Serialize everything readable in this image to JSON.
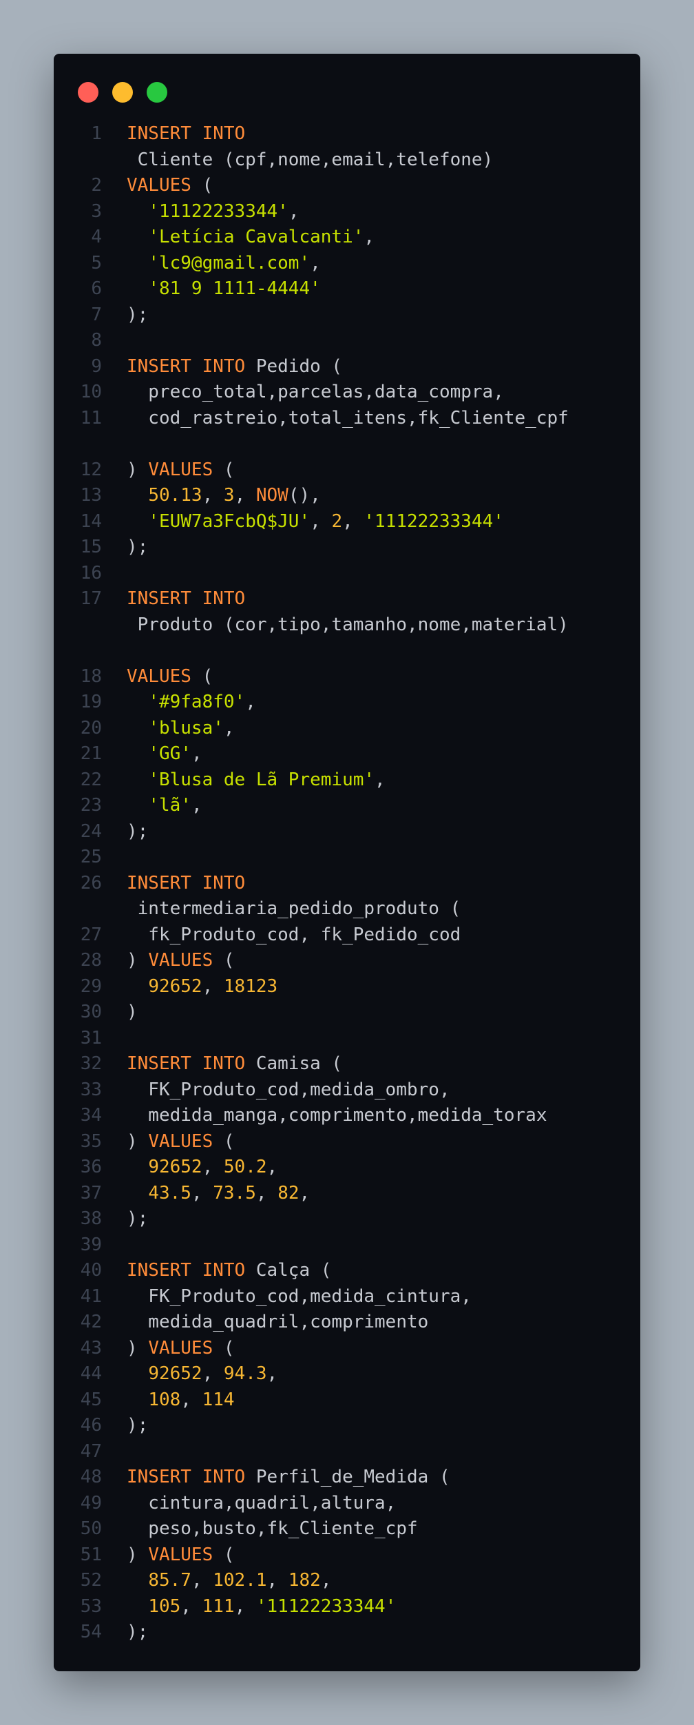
{
  "window": {
    "controls": [
      "close",
      "minimize",
      "maximize"
    ],
    "colors": {
      "close": "#ff5f57",
      "minimize": "#febc2e",
      "maximize": "#28c840",
      "keyword": "#ff8c3a",
      "string": "#c7e000",
      "number": "#f7b733",
      "text": "#c7cad1",
      "line_number": "#3d4452",
      "background": "#0b0d13"
    }
  },
  "code": {
    "lines": [
      {
        "n": "1",
        "tokens": [
          {
            "t": "INSERT INTO",
            "c": "kw"
          }
        ]
      },
      {
        "n": "",
        "tokens": [
          {
            "t": " Cliente (cpf,nome,email,telefone)",
            "c": "pn"
          }
        ]
      },
      {
        "n": "2",
        "tokens": [
          {
            "t": "VALUES",
            "c": "kw"
          },
          {
            "t": " (",
            "c": "pn"
          }
        ]
      },
      {
        "n": "3",
        "tokens": [
          {
            "t": "  ",
            "c": "pn"
          },
          {
            "t": "'11122233344'",
            "c": "str"
          },
          {
            "t": ",",
            "c": "pn"
          }
        ]
      },
      {
        "n": "4",
        "tokens": [
          {
            "t": "  ",
            "c": "pn"
          },
          {
            "t": "'Letícia Cavalcanti'",
            "c": "str"
          },
          {
            "t": ",",
            "c": "pn"
          }
        ]
      },
      {
        "n": "5",
        "tokens": [
          {
            "t": "  ",
            "c": "pn"
          },
          {
            "t": "'lc9@gmail.com'",
            "c": "str"
          },
          {
            "t": ",",
            "c": "pn"
          }
        ]
      },
      {
        "n": "6",
        "tokens": [
          {
            "t": "  ",
            "c": "pn"
          },
          {
            "t": "'81 9 1111-4444'",
            "c": "str"
          }
        ]
      },
      {
        "n": "7",
        "tokens": [
          {
            "t": ");",
            "c": "pn"
          }
        ]
      },
      {
        "n": "8",
        "tokens": []
      },
      {
        "n": "9",
        "tokens": [
          {
            "t": "INSERT INTO",
            "c": "kw"
          },
          {
            "t": " Pedido (",
            "c": "pn"
          }
        ]
      },
      {
        "n": "10",
        "tokens": [
          {
            "t": "  preco_total,parcelas,data_compra,",
            "c": "pn"
          }
        ]
      },
      {
        "n": "11",
        "tokens": [
          {
            "t": "  cod_rastreio,total_itens,fk_Cliente_cpf",
            "c": "pn"
          }
        ]
      },
      {
        "n": "",
        "tokens": []
      },
      {
        "n": "12",
        "tokens": [
          {
            "t": ") ",
            "c": "pn"
          },
          {
            "t": "VALUES",
            "c": "kw"
          },
          {
            "t": " (",
            "c": "pn"
          }
        ]
      },
      {
        "n": "13",
        "tokens": [
          {
            "t": "  ",
            "c": "pn"
          },
          {
            "t": "50.13",
            "c": "num"
          },
          {
            "t": ", ",
            "c": "pn"
          },
          {
            "t": "3",
            "c": "num"
          },
          {
            "t": ", ",
            "c": "pn"
          },
          {
            "t": "NOW",
            "c": "kw"
          },
          {
            "t": "(),",
            "c": "pn"
          }
        ]
      },
      {
        "n": "14",
        "tokens": [
          {
            "t": "  ",
            "c": "pn"
          },
          {
            "t": "'EUW7a3FcbQ$JU'",
            "c": "str"
          },
          {
            "t": ", ",
            "c": "pn"
          },
          {
            "t": "2",
            "c": "num"
          },
          {
            "t": ", ",
            "c": "pn"
          },
          {
            "t": "'11122233344'",
            "c": "str"
          }
        ]
      },
      {
        "n": "15",
        "tokens": [
          {
            "t": ");",
            "c": "pn"
          }
        ]
      },
      {
        "n": "16",
        "tokens": []
      },
      {
        "n": "17",
        "tokens": [
          {
            "t": "INSERT INTO",
            "c": "kw"
          }
        ]
      },
      {
        "n": "",
        "tokens": [
          {
            "t": " Produto (cor,tipo,tamanho,nome,material)",
            "c": "pn"
          }
        ]
      },
      {
        "n": "",
        "tokens": []
      },
      {
        "n": "18",
        "tokens": [
          {
            "t": "VALUES",
            "c": "kw"
          },
          {
            "t": " (",
            "c": "pn"
          }
        ]
      },
      {
        "n": "19",
        "tokens": [
          {
            "t": "  ",
            "c": "pn"
          },
          {
            "t": "'#9fa8f0'",
            "c": "str"
          },
          {
            "t": ",",
            "c": "pn"
          }
        ]
      },
      {
        "n": "20",
        "tokens": [
          {
            "t": "  ",
            "c": "pn"
          },
          {
            "t": "'blusa'",
            "c": "str"
          },
          {
            "t": ",",
            "c": "pn"
          }
        ]
      },
      {
        "n": "21",
        "tokens": [
          {
            "t": "  ",
            "c": "pn"
          },
          {
            "t": "'GG'",
            "c": "str"
          },
          {
            "t": ",",
            "c": "pn"
          }
        ]
      },
      {
        "n": "22",
        "tokens": [
          {
            "t": "  ",
            "c": "pn"
          },
          {
            "t": "'Blusa de Lã Premium'",
            "c": "str"
          },
          {
            "t": ",",
            "c": "pn"
          }
        ]
      },
      {
        "n": "23",
        "tokens": [
          {
            "t": "  ",
            "c": "pn"
          },
          {
            "t": "'lã'",
            "c": "str"
          },
          {
            "t": ",",
            "c": "pn"
          }
        ]
      },
      {
        "n": "24",
        "tokens": [
          {
            "t": ");",
            "c": "pn"
          }
        ]
      },
      {
        "n": "25",
        "tokens": []
      },
      {
        "n": "26",
        "tokens": [
          {
            "t": "INSERT INTO",
            "c": "kw"
          }
        ]
      },
      {
        "n": "",
        "tokens": [
          {
            "t": " intermediaria_pedido_produto (",
            "c": "pn"
          }
        ]
      },
      {
        "n": "27",
        "tokens": [
          {
            "t": "  fk_Produto_cod, fk_Pedido_cod",
            "c": "pn"
          }
        ]
      },
      {
        "n": "28",
        "tokens": [
          {
            "t": ") ",
            "c": "pn"
          },
          {
            "t": "VALUES",
            "c": "kw"
          },
          {
            "t": " (",
            "c": "pn"
          }
        ]
      },
      {
        "n": "29",
        "tokens": [
          {
            "t": "  ",
            "c": "pn"
          },
          {
            "t": "92652",
            "c": "num"
          },
          {
            "t": ", ",
            "c": "pn"
          },
          {
            "t": "18123",
            "c": "num"
          }
        ]
      },
      {
        "n": "30",
        "tokens": [
          {
            "t": ")",
            "c": "pn"
          }
        ]
      },
      {
        "n": "31",
        "tokens": []
      },
      {
        "n": "32",
        "tokens": [
          {
            "t": "INSERT INTO",
            "c": "kw"
          },
          {
            "t": " Camisa (",
            "c": "pn"
          }
        ]
      },
      {
        "n": "33",
        "tokens": [
          {
            "t": "  FK_Produto_cod,medida_ombro,",
            "c": "pn"
          }
        ]
      },
      {
        "n": "34",
        "tokens": [
          {
            "t": "  medida_manga,comprimento,medida_torax",
            "c": "pn"
          }
        ]
      },
      {
        "n": "35",
        "tokens": [
          {
            "t": ") ",
            "c": "pn"
          },
          {
            "t": "VALUES",
            "c": "kw"
          },
          {
            "t": " (",
            "c": "pn"
          }
        ]
      },
      {
        "n": "36",
        "tokens": [
          {
            "t": "  ",
            "c": "pn"
          },
          {
            "t": "92652",
            "c": "num"
          },
          {
            "t": ", ",
            "c": "pn"
          },
          {
            "t": "50.2",
            "c": "num"
          },
          {
            "t": ",",
            "c": "pn"
          }
        ]
      },
      {
        "n": "37",
        "tokens": [
          {
            "t": "  ",
            "c": "pn"
          },
          {
            "t": "43.5",
            "c": "num"
          },
          {
            "t": ", ",
            "c": "pn"
          },
          {
            "t": "73.5",
            "c": "num"
          },
          {
            "t": ", ",
            "c": "pn"
          },
          {
            "t": "82",
            "c": "num"
          },
          {
            "t": ",",
            "c": "pn"
          }
        ]
      },
      {
        "n": "38",
        "tokens": [
          {
            "t": ");",
            "c": "pn"
          }
        ]
      },
      {
        "n": "39",
        "tokens": []
      },
      {
        "n": "40",
        "tokens": [
          {
            "t": "INSERT INTO",
            "c": "kw"
          },
          {
            "t": " Calça (",
            "c": "pn"
          }
        ]
      },
      {
        "n": "41",
        "tokens": [
          {
            "t": "  FK_Produto_cod,medida_cintura,",
            "c": "pn"
          }
        ]
      },
      {
        "n": "42",
        "tokens": [
          {
            "t": "  medida_quadril,comprimento",
            "c": "pn"
          }
        ]
      },
      {
        "n": "43",
        "tokens": [
          {
            "t": ") ",
            "c": "pn"
          },
          {
            "t": "VALUES",
            "c": "kw"
          },
          {
            "t": " (",
            "c": "pn"
          }
        ]
      },
      {
        "n": "44",
        "tokens": [
          {
            "t": "  ",
            "c": "pn"
          },
          {
            "t": "92652",
            "c": "num"
          },
          {
            "t": ", ",
            "c": "pn"
          },
          {
            "t": "94.3",
            "c": "num"
          },
          {
            "t": ",",
            "c": "pn"
          }
        ]
      },
      {
        "n": "45",
        "tokens": [
          {
            "t": "  ",
            "c": "pn"
          },
          {
            "t": "108",
            "c": "num"
          },
          {
            "t": ", ",
            "c": "pn"
          },
          {
            "t": "114",
            "c": "num"
          }
        ]
      },
      {
        "n": "46",
        "tokens": [
          {
            "t": ");",
            "c": "pn"
          }
        ]
      },
      {
        "n": "47",
        "tokens": []
      },
      {
        "n": "48",
        "tokens": [
          {
            "t": "INSERT INTO",
            "c": "kw"
          },
          {
            "t": " Perfil_de_Medida (",
            "c": "pn"
          }
        ]
      },
      {
        "n": "49",
        "tokens": [
          {
            "t": "  cintura,quadril,altura,",
            "c": "pn"
          }
        ]
      },
      {
        "n": "50",
        "tokens": [
          {
            "t": "  peso,busto,fk_Cliente_cpf",
            "c": "pn"
          }
        ]
      },
      {
        "n": "51",
        "tokens": [
          {
            "t": ") ",
            "c": "pn"
          },
          {
            "t": "VALUES",
            "c": "kw"
          },
          {
            "t": " (",
            "c": "pn"
          }
        ]
      },
      {
        "n": "52",
        "tokens": [
          {
            "t": "  ",
            "c": "pn"
          },
          {
            "t": "85.7",
            "c": "num"
          },
          {
            "t": ", ",
            "c": "pn"
          },
          {
            "t": "102.1",
            "c": "num"
          },
          {
            "t": ", ",
            "c": "pn"
          },
          {
            "t": "182",
            "c": "num"
          },
          {
            "t": ",",
            "c": "pn"
          }
        ]
      },
      {
        "n": "53",
        "tokens": [
          {
            "t": "  ",
            "c": "pn"
          },
          {
            "t": "105",
            "c": "num"
          },
          {
            "t": ", ",
            "c": "pn"
          },
          {
            "t": "111",
            "c": "num"
          },
          {
            "t": ", ",
            "c": "pn"
          },
          {
            "t": "'11122233344'",
            "c": "str"
          }
        ]
      },
      {
        "n": "54",
        "tokens": [
          {
            "t": ");",
            "c": "pn"
          }
        ]
      }
    ]
  }
}
